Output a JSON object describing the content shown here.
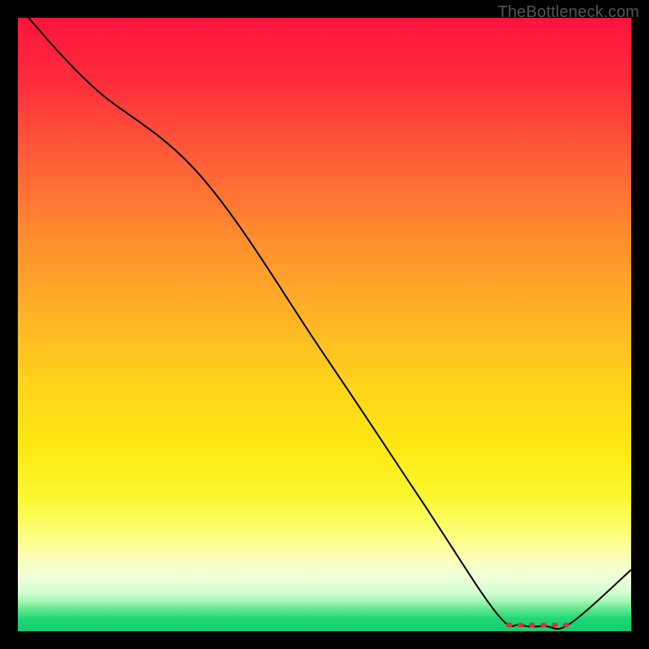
{
  "watermark": "TheBottleneck.com",
  "chart_data": {
    "type": "line",
    "title": "",
    "xlabel": "",
    "ylabel": "",
    "xlim": [
      0,
      100
    ],
    "ylim": [
      0,
      100
    ],
    "grid": false,
    "series": [
      {
        "name": "curve",
        "x": [
          0,
          12,
          30,
          50,
          66,
          78,
          82,
          86,
          90,
          100
        ],
        "values": [
          102,
          89,
          74,
          45,
          21,
          3,
          1,
          0.8,
          1.2,
          10
        ]
      }
    ],
    "annotations": [
      {
        "name": "minimum-band",
        "type": "dotted-segment",
        "x_start": 80,
        "x_end": 90,
        "y": 1
      }
    ],
    "colors": {
      "curve": "#000000",
      "minimum_band": "#cc3a3a",
      "gradient_top": "#ff143c",
      "gradient_bottom": "#12ce70"
    }
  }
}
